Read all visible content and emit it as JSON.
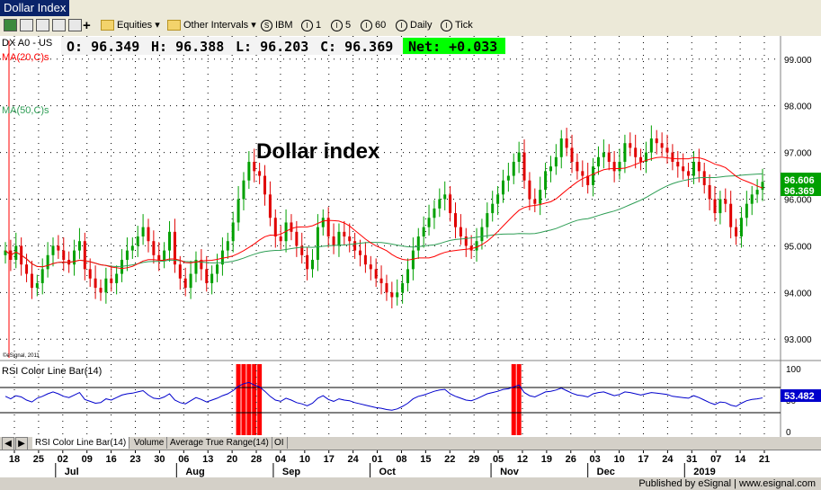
{
  "window": {
    "title": "Dollar Index"
  },
  "toolbar": {
    "equities_label": "Equities",
    "other_intervals_label": "Other Intervals",
    "intervals": [
      {
        "icon": "S",
        "label": "IBM"
      },
      {
        "icon": "I",
        "label": "1"
      },
      {
        "icon": "I",
        "label": "5"
      },
      {
        "icon": "I",
        "label": "60"
      },
      {
        "icon": "I",
        "label": "Daily"
      },
      {
        "icon": "I",
        "label": "Tick"
      }
    ]
  },
  "quote": {
    "symbol": "DX A0 - US",
    "open": "O: 96.349",
    "high": "H: 96.388",
    "low": "L: 96.203",
    "close": "C: 96.369",
    "net": "Net: +0.033"
  },
  "colors": {
    "up": "#00a000",
    "down": "#e00000",
    "ma20": "#ff0000",
    "ma50": "#2e9e55",
    "rsi": "#0000cc",
    "net_bg": "#00ff00"
  },
  "chart_data": {
    "type": "candlestick",
    "title": "Dollar index",
    "ylim": [
      92.6,
      99.4
    ],
    "y_ticks": [
      "99.000",
      "98.000",
      "97.000",
      "96.000",
      "95.000",
      "94.000",
      "93.000"
    ],
    "indicators": [
      "MA(20,C)s",
      "MA(50,C)s"
    ],
    "last_values": {
      "ma50": "96.606",
      "close": "96.369"
    },
    "series": [
      {
        "name": "DX A0 - US",
        "close": [
          94.9,
          94.7,
          95.0,
          94.6,
          94.4,
          94.1,
          94.2,
          94.5,
          94.8,
          95.0,
          94.9,
          94.7,
          94.6,
          94.9,
          95.1,
          94.5,
          94.3,
          94.1,
          94.0,
          94.3,
          94.2,
          94.4,
          94.7,
          94.9,
          95.0,
          95.2,
          95.4,
          95.1,
          94.8,
          94.7,
          94.9,
          95.3,
          94.6,
          94.3,
          94.1,
          94.4,
          94.7,
          94.5,
          94.2,
          94.4,
          94.6,
          94.9,
          95.1,
          95.5,
          96.0,
          96.4,
          96.8,
          96.6,
          96.5,
          96.1,
          95.6,
          95.2,
          95.1,
          95.5,
          95.3,
          95.0,
          94.8,
          94.5,
          94.7,
          95.4,
          95.6,
          95.2,
          95.0,
          95.3,
          95.2,
          95.1,
          94.9,
          94.8,
          94.6,
          94.5,
          94.3,
          94.2,
          94.0,
          93.9,
          94.0,
          94.2,
          94.5,
          94.9,
          95.2,
          95.4,
          95.6,
          95.8,
          96.0,
          96.1,
          95.7,
          95.4,
          95.2,
          95.0,
          94.9,
          95.1,
          95.4,
          95.7,
          95.9,
          96.1,
          96.4,
          96.5,
          96.8,
          97.0,
          96.4,
          96.0,
          95.9,
          96.2,
          96.6,
          96.7,
          96.9,
          97.3,
          97.1,
          96.8,
          96.6,
          96.5,
          96.3,
          96.7,
          96.9,
          97.0,
          96.8,
          96.6,
          96.8,
          97.2,
          97.1,
          96.9,
          96.8,
          97.0,
          97.3,
          97.2,
          97.1,
          97.0,
          96.8,
          96.7,
          96.6,
          96.5,
          96.8,
          96.6,
          96.3,
          96.0,
          95.7,
          96.0,
          95.9,
          95.4,
          95.2,
          95.6,
          95.9,
          96.1,
          96.2,
          96.37
        ]
      }
    ]
  },
  "rsi": {
    "label": "RSI Color Line Bar(14)",
    "last_value": "53.482",
    "y_ticks": [
      "100",
      "50",
      "0"
    ],
    "upper": 70,
    "lower": 30,
    "values": [
      56,
      52,
      57,
      55,
      50,
      47,
      53,
      56,
      60,
      63,
      60,
      56,
      54,
      58,
      62,
      51,
      48,
      45,
      46,
      52,
      50,
      54,
      58,
      60,
      61,
      63,
      65,
      58,
      53,
      52,
      55,
      60,
      50,
      46,
      44,
      49,
      54,
      51,
      47,
      50,
      53,
      57,
      60,
      65,
      72,
      76,
      78,
      74,
      71,
      64,
      56,
      50,
      48,
      53,
      50,
      46,
      44,
      41,
      45,
      53,
      57,
      51,
      48,
      52,
      50,
      49,
      46,
      44,
      42,
      40,
      38,
      37,
      35,
      34,
      36,
      40,
      45,
      52,
      56,
      58,
      61,
      64,
      66,
      67,
      60,
      56,
      53,
      50,
      49,
      52,
      56,
      60,
      62,
      64,
      67,
      68,
      71,
      74,
      62,
      57,
      55,
      59,
      63,
      64,
      66,
      69,
      65,
      61,
      58,
      57,
      55,
      60,
      62,
      63,
      60,
      57,
      59,
      63,
      62,
      60,
      58,
      60,
      62,
      61,
      60,
      59,
      56,
      55,
      54,
      53,
      57,
      54,
      50,
      46,
      43,
      47,
      46,
      42,
      40,
      45,
      49,
      51,
      52,
      53.48
    ]
  },
  "nav": {
    "tabs": [
      "RSI Color Line Bar(14)",
      "Volume",
      "Average True Range(14)",
      "OI"
    ]
  },
  "xaxis": {
    "days": [
      "18",
      "25",
      "02",
      "09",
      "16",
      "23",
      "30",
      "06",
      "13",
      "20",
      "28",
      "04",
      "10",
      "17",
      "24",
      "01",
      "08",
      "15",
      "22",
      "29",
      "05",
      "12",
      "19",
      "26",
      "03",
      "10",
      "17",
      "24",
      "31",
      "07",
      "14",
      "21"
    ],
    "months": [
      "Jul",
      "Aug",
      "Sep",
      "Oct",
      "Nov",
      "Dec",
      "2019"
    ]
  },
  "footer": {
    "text": "Published by eSignal | www.esignal.com"
  },
  "copyright": "©eSignal, 2011"
}
